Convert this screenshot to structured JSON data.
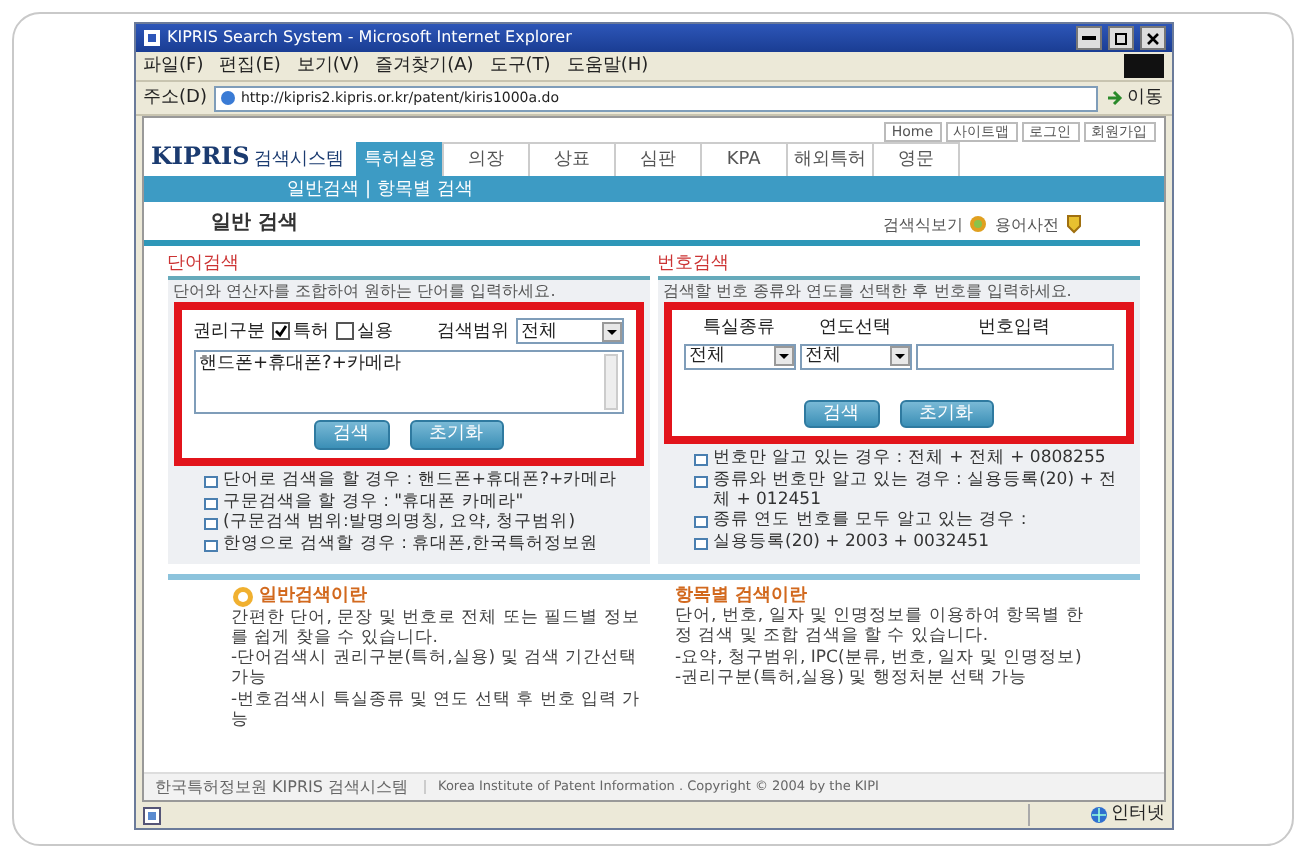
{
  "window": {
    "title": "KIPRIS Search System - Microsoft Internet Explorer"
  },
  "menu": [
    "파일(F)",
    "편집(E)",
    "보기(V)",
    "즐겨찾기(A)",
    "도구(T)",
    "도움말(H)"
  ],
  "address_bar": {
    "label": "주소(D)",
    "url": "http://kipris2.kipris.or.kr/patent/kiris1000a.do",
    "go": "이동"
  },
  "top_links": [
    "Home",
    "사이트맵",
    "로그인",
    "회원가입"
  ],
  "logo": {
    "brand": "KIPRIS",
    "subtitle": "검색시스템"
  },
  "tabs": [
    {
      "label": "특허실용",
      "selected": true
    },
    {
      "label": "의장",
      "selected": false
    },
    {
      "label": "상표",
      "selected": false
    },
    {
      "label": "심판",
      "selected": false
    },
    {
      "label": "KPA",
      "selected": false
    },
    {
      "label": "해외특허",
      "selected": false
    },
    {
      "label": "영문",
      "selected": false
    }
  ],
  "subnav": [
    "일반검색",
    "항목별 검색"
  ],
  "subnav_separator": "|",
  "page_title": {
    "text": "일반 검색",
    "links": [
      "검색식보기",
      "용어사전"
    ]
  },
  "panels": [
    {
      "kind": "word",
      "heading": "단어검색",
      "description": "단어와 연산자를 조합하여 원하는 단어를 입력하세요.",
      "highlighted": true,
      "rights_label": "권리구분",
      "checkboxes": [
        {
          "label": "특허",
          "checked": true
        },
        {
          "label": "실용",
          "checked": false
        }
      ],
      "scope_label": "검색범위",
      "scope": "전체",
      "query": "핸드폰+휴대폰?+카메라",
      "buttons": [
        "검색",
        "초기화"
      ],
      "help": [
        "단어로 검색을 할 경우 : 핸드폰+휴대폰?+카메라",
        "구문검색을 할 경우 : \"휴대폰 카메라\"",
        "(구문검색 범위:발명의명칭, 요약, 청구범위)",
        "한영으로 검색할 경우 : 휴대폰,한국특허정보원"
      ]
    },
    {
      "kind": "number",
      "heading": "번호검색",
      "description": "검색할 번호 종류와 연도를 선택한 후 번호를 입력하세요.",
      "highlighted": true,
      "columns": [
        "특실종류",
        "연도선택",
        "번호입력"
      ],
      "selects": [
        "전체",
        "전체"
      ],
      "buttons": [
        "검색",
        "초기화"
      ],
      "help": [
        "번호만 알고 있는 경우 : 전체 + 전체 + 0808255",
        "종류와 번호만 알고 있는 경우 : 실용등록(20) + 전체 + 012451",
        "종류 연도 번호를 모두 알고 있는 경우 :",
        "실용등록(20) + 2003 + 0032451"
      ]
    }
  ],
  "guides": [
    {
      "title": "일반검색이란",
      "paragraphs": [
        "간편한 단어, 문장 및 번호로 전체 또는 필드별 정보를 쉽게 찾을 수 있습니다.",
        "-단어검색시 권리구분(특허,실용) 및 검색 기간선택 가능",
        "-번호검색시 특실종류 및 연도 선택 후 번호 입력 가능"
      ]
    },
    {
      "title": "항목별 검색이란",
      "paragraphs": [
        "단어, 번호, 일자 및 인명정보를 이용하여 항목별 한정 검색 및 조합 검색을 할 수 있습니다.",
        "-요약, 청구범위, IPC(분류, 번호, 일자 및 인명정보)",
        "-권리구분(특허,실용) 및 행정처분 선택 가능"
      ]
    }
  ],
  "footer": {
    "org": "한국특허정보원 KIPRIS 검색시스템",
    "copyright": "Korea Institute of Patent Information . Copyright © 2004 by the KIPI"
  },
  "status_bar": {
    "zone": "인터넷"
  }
}
